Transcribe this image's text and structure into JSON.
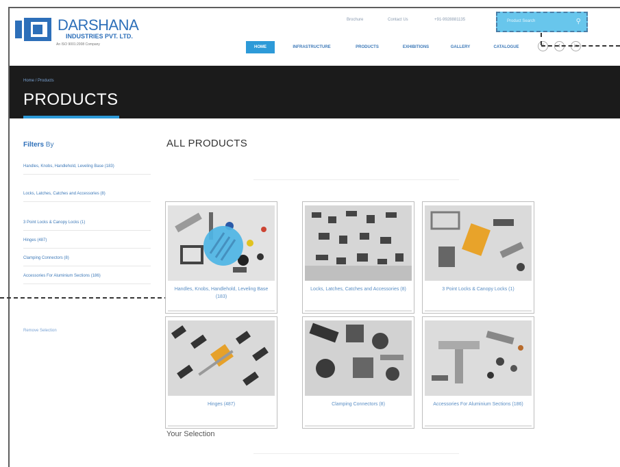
{
  "brand": {
    "name": "DARSHANA",
    "subtitle": "INDUSTRIES PVT. LTD.",
    "tagline": "An ISO 9001:2008 Company"
  },
  "top_links": [
    "Brochure",
    "Contact Us",
    "+91-9928881135"
  ],
  "search": {
    "placeholder": "Product Search"
  },
  "nav": {
    "items": [
      {
        "label": "HOME",
        "active": true
      },
      {
        "label": "INFRASTRUCTURE",
        "active": false
      },
      {
        "label": "PRODUCTS",
        "active": false
      },
      {
        "label": "EXHIBITIONS",
        "active": false
      },
      {
        "label": "GALLERY",
        "active": false
      },
      {
        "label": "CATALOGUE",
        "active": false
      }
    ],
    "social_icons": [
      "facebook-icon",
      "twitter-icon",
      "linkedin-icon"
    ]
  },
  "hero": {
    "breadcrumb": "Home / Products",
    "title": "PRODUCTS"
  },
  "filters": {
    "title_bold": "Filters",
    "title_rest": " By",
    "items": [
      "Handles, Knobs, Handlehold, Leveling Base (183)",
      "Locks, Latches, Catches and Accessories (8)",
      "3 Point Locks & Canopy Locks (1)",
      "Hinges (487)",
      "Clamping Connectors (8)",
      "Accessories For Aluminium Sections (186)"
    ],
    "reset_label": "Remove Selection"
  },
  "products": {
    "heading": "ALL PRODUCTS",
    "cards": [
      {
        "label": "Handles, Knobs, Handlehold, Leveling Base (183)",
        "tone": "#d9d9d9"
      },
      {
        "label": "Locks, Latches, Catches and Accessories (8)",
        "tone": "#cfcfcf"
      },
      {
        "label": "3 Point Locks & Canopy Locks (1)",
        "tone": "#d5d5d5"
      },
      {
        "label": "Hinges (487)",
        "tone": "#d4d4d4"
      },
      {
        "label": "Clamping Connectors (8)",
        "tone": "#cdcdcd"
      },
      {
        "label": "Accessories For Aluminium Sections (186)",
        "tone": "#d8d8d8"
      }
    ]
  },
  "selection": {
    "label": "Your Selection"
  },
  "colors": {
    "accent": "#2d9ad8",
    "brand": "#2d6fb9",
    "hero_bg": "#1b1b1b",
    "highlight": "#68c6ec"
  }
}
